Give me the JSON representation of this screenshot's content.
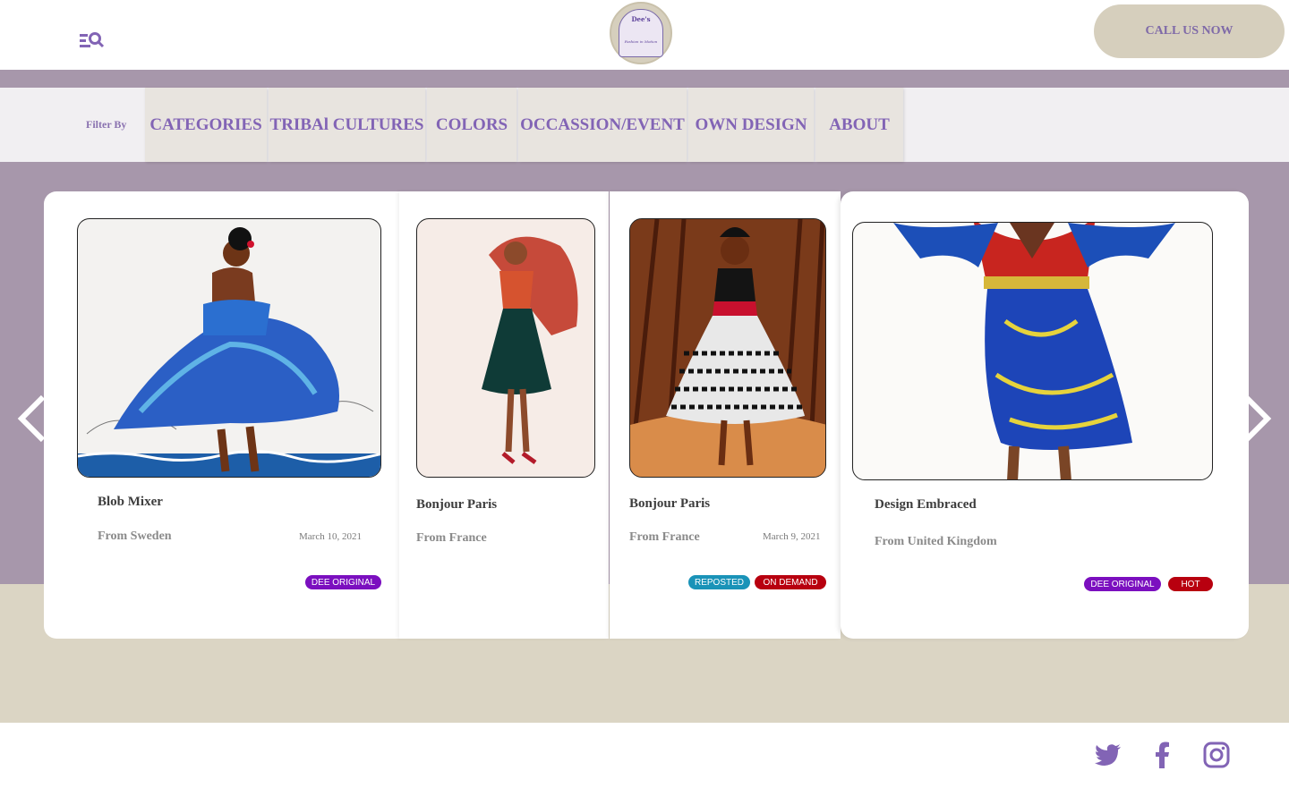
{
  "header": {
    "logo_title": "Dee's",
    "logo_subtitle": "Fashion in Motion",
    "call_label": "CALL US NOW"
  },
  "filter": {
    "label": "Filter By",
    "tabs": [
      "CATEGORIES",
      "TRIBAl CULTURES",
      "COLORS",
      "OCCASSION/EVENT",
      "OWN DESIGN",
      "ABOUT"
    ]
  },
  "cards": [
    {
      "title": "Blob Mixer",
      "origin": "From Sweden",
      "date": "March 10, 2021",
      "badges": [
        "DEE ORIGINAL"
      ]
    },
    {
      "title": "Bonjour Paris",
      "origin": "From France",
      "date": "",
      "badges": []
    },
    {
      "title": "Bonjour Paris",
      "origin": "From France",
      "date": "March 9, 2021",
      "badges": [
        "REPOSTED",
        "ON DEMAND"
      ]
    },
    {
      "title": "Design Embraced",
      "origin": "From United Kingdom",
      "date": "",
      "badges": [
        "DEE ORIGINAL",
        "HOT"
      ]
    }
  ],
  "colors": {
    "accent_purple": "#8264b5",
    "band": "#a797ab",
    "beige": "#dbd5c4",
    "badge_original": "#7b0fbf",
    "badge_reposted": "#1a93b8",
    "badge_hot": "#b8000f"
  },
  "icons": [
    "menu-search-icon",
    "chevron-left-icon",
    "chevron-right-icon",
    "twitter-icon",
    "facebook-icon",
    "instagram-icon"
  ]
}
